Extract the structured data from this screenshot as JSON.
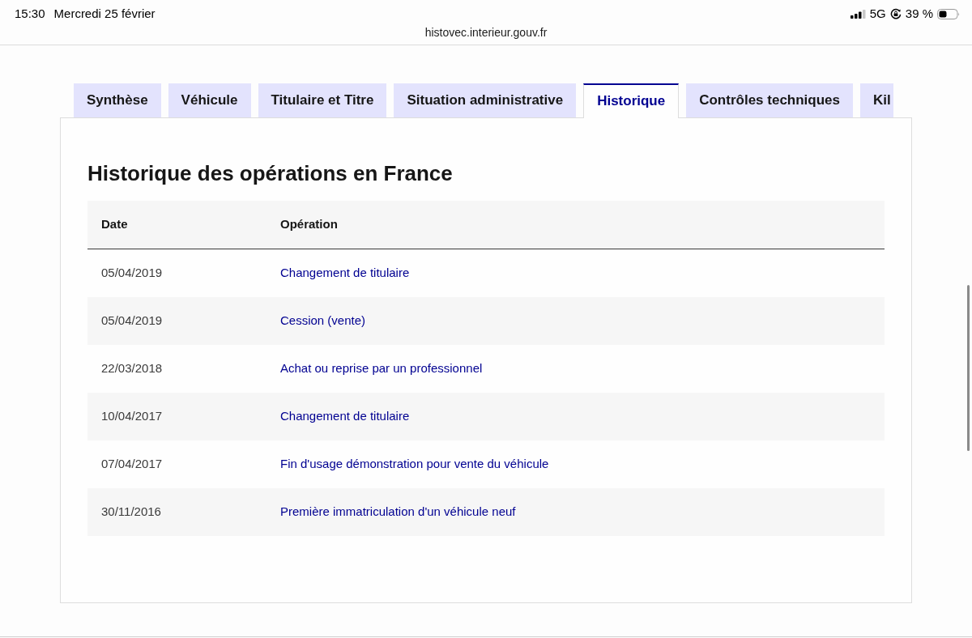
{
  "status_bar": {
    "time": "15:30",
    "date": "Mercredi 25 février",
    "network": "5G",
    "battery": "39 %"
  },
  "address_bar": {
    "url": "histovec.interieur.gouv.fr"
  },
  "tabs": [
    {
      "label": "Synthèse",
      "selected": false
    },
    {
      "label": "Véhicule",
      "selected": false
    },
    {
      "label": "Titulaire et Titre",
      "selected": false
    },
    {
      "label": "Situation administrative",
      "selected": false
    },
    {
      "label": "Historique",
      "selected": true
    },
    {
      "label": "Contrôles techniques",
      "selected": false
    },
    {
      "label": "Kil",
      "selected": false
    }
  ],
  "panel": {
    "title": "Historique des opérations en France",
    "table": {
      "columns": [
        "Date",
        "Opération"
      ],
      "rows": [
        {
          "date": "05/04/2019",
          "operation": "Changement de titulaire"
        },
        {
          "date": "05/04/2019",
          "operation": "Cession (vente)"
        },
        {
          "date": "22/03/2018",
          "operation": "Achat ou reprise par un professionnel"
        },
        {
          "date": "10/04/2017",
          "operation": "Changement de titulaire"
        },
        {
          "date": "07/04/2017",
          "operation": "Fin d'usage démonstration pour vente du véhicule"
        },
        {
          "date": "30/11/2016",
          "operation": "Première immatriculation d'un véhicule neuf"
        }
      ]
    }
  }
}
